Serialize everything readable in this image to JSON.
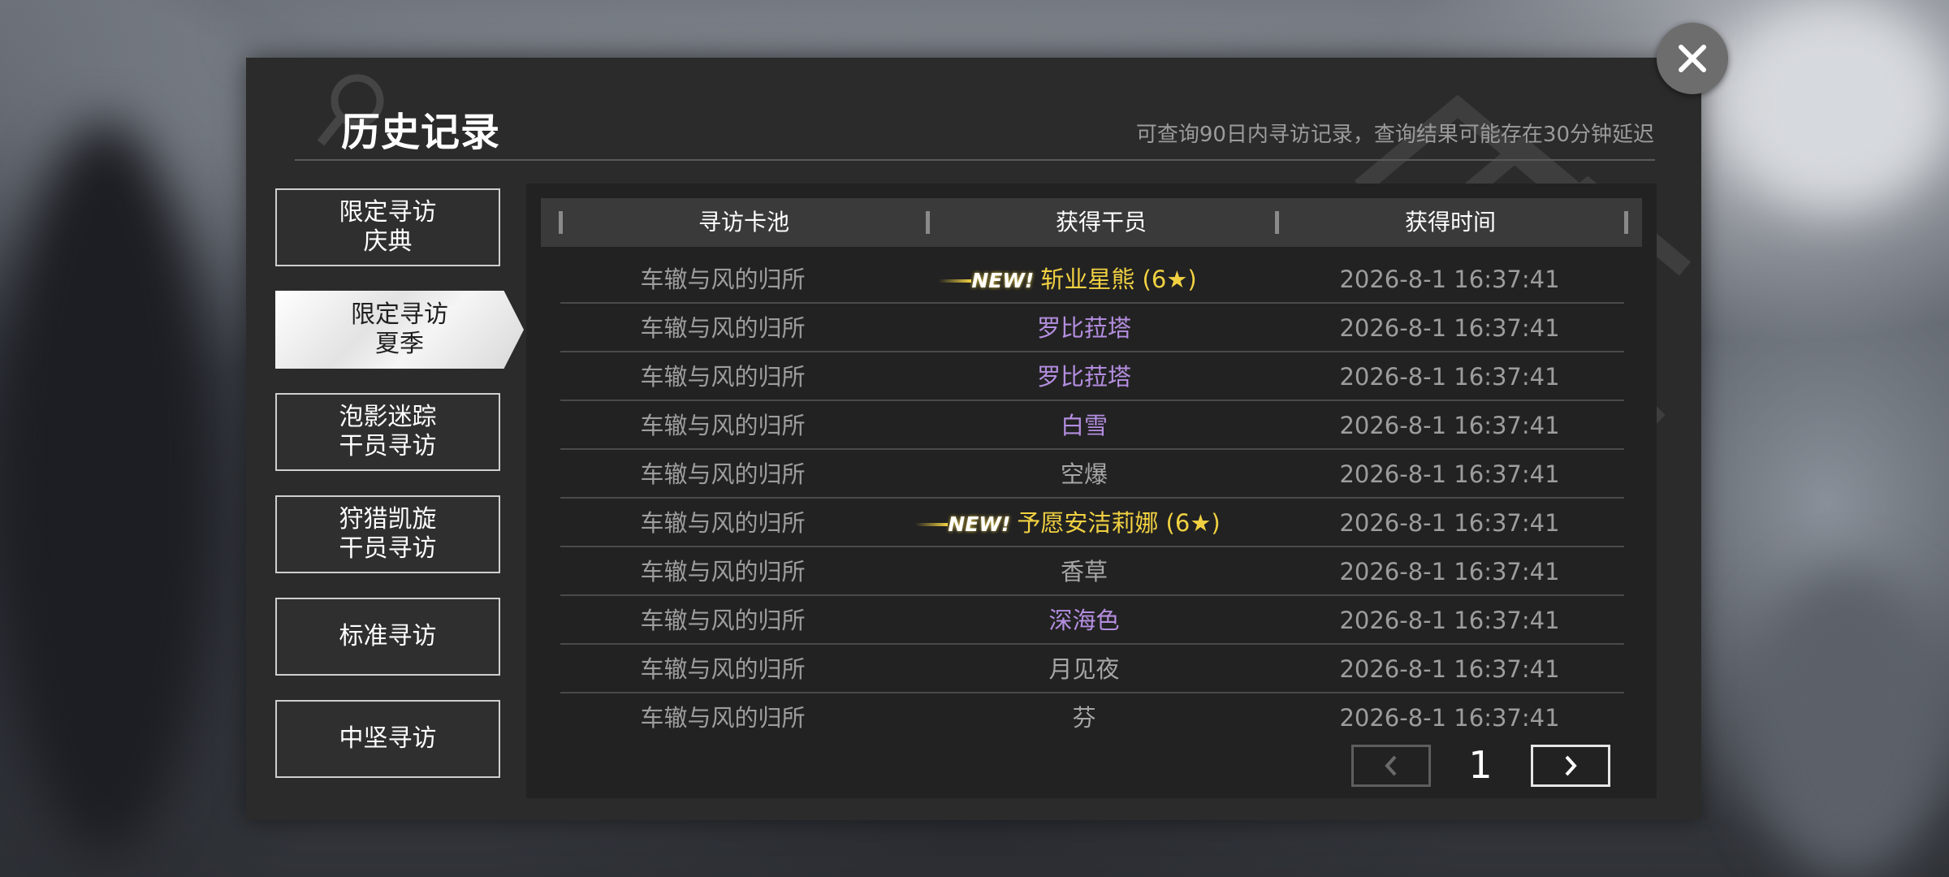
{
  "dialog": {
    "title": "历史记录",
    "subtitle": "可查询90日内寻访记录，查询结果可能存在30分钟延迟"
  },
  "sidebar": {
    "items": [
      {
        "label": "限定寻访\n庆典",
        "active": false
      },
      {
        "label": "限定寻访\n夏季",
        "active": true
      },
      {
        "label": "泡影迷踪\n干员寻访",
        "active": false
      },
      {
        "label": "狩猎凯旋\n干员寻访",
        "active": false
      },
      {
        "label": "标准寻访",
        "active": false
      },
      {
        "label": "中坚寻访",
        "active": false
      }
    ]
  },
  "table": {
    "headers": [
      "寻访卡池",
      "获得干员",
      "获得时间"
    ],
    "rows": [
      {
        "pool": "车辙与风的归所",
        "new_tag": "NEW!",
        "operator": "斩业星熊 (6★)",
        "style": "gold",
        "time": "2026-8-1 16:37:41"
      },
      {
        "pool": "车辙与风的归所",
        "new_tag": "",
        "operator": "罗比菈塔",
        "style": "purple",
        "time": "2026-8-1 16:37:41"
      },
      {
        "pool": "车辙与风的归所",
        "new_tag": "",
        "operator": "罗比菈塔",
        "style": "purple",
        "time": "2026-8-1 16:37:41"
      },
      {
        "pool": "车辙与风的归所",
        "new_tag": "",
        "operator": "白雪",
        "style": "purple",
        "time": "2026-8-1 16:37:41"
      },
      {
        "pool": "车辙与风的归所",
        "new_tag": "",
        "operator": "空爆",
        "style": "normal",
        "time": "2026-8-1 16:37:41"
      },
      {
        "pool": "车辙与风的归所",
        "new_tag": "NEW!",
        "operator": "予愿安洁莉娜 (6★)",
        "style": "gold",
        "time": "2026-8-1 16:37:41"
      },
      {
        "pool": "车辙与风的归所",
        "new_tag": "",
        "operator": "香草",
        "style": "normal",
        "time": "2026-8-1 16:37:41"
      },
      {
        "pool": "车辙与风的归所",
        "new_tag": "",
        "operator": "深海色",
        "style": "purple",
        "time": "2026-8-1 16:37:41"
      },
      {
        "pool": "车辙与风的归所",
        "new_tag": "",
        "operator": "月见夜",
        "style": "normal",
        "time": "2026-8-1 16:37:41"
      },
      {
        "pool": "车辙与风的归所",
        "new_tag": "",
        "operator": "芬",
        "style": "normal",
        "time": "2026-8-1 16:37:41"
      }
    ]
  },
  "pagination": {
    "page": "1",
    "prev_icon": "chevron-left-icon",
    "next_icon": "chevron-right-icon"
  },
  "colors": {
    "gold": "#f1d142",
    "purple": "#b48ee0",
    "normal": "#a6a6a6"
  },
  "close_icon": "close-icon"
}
